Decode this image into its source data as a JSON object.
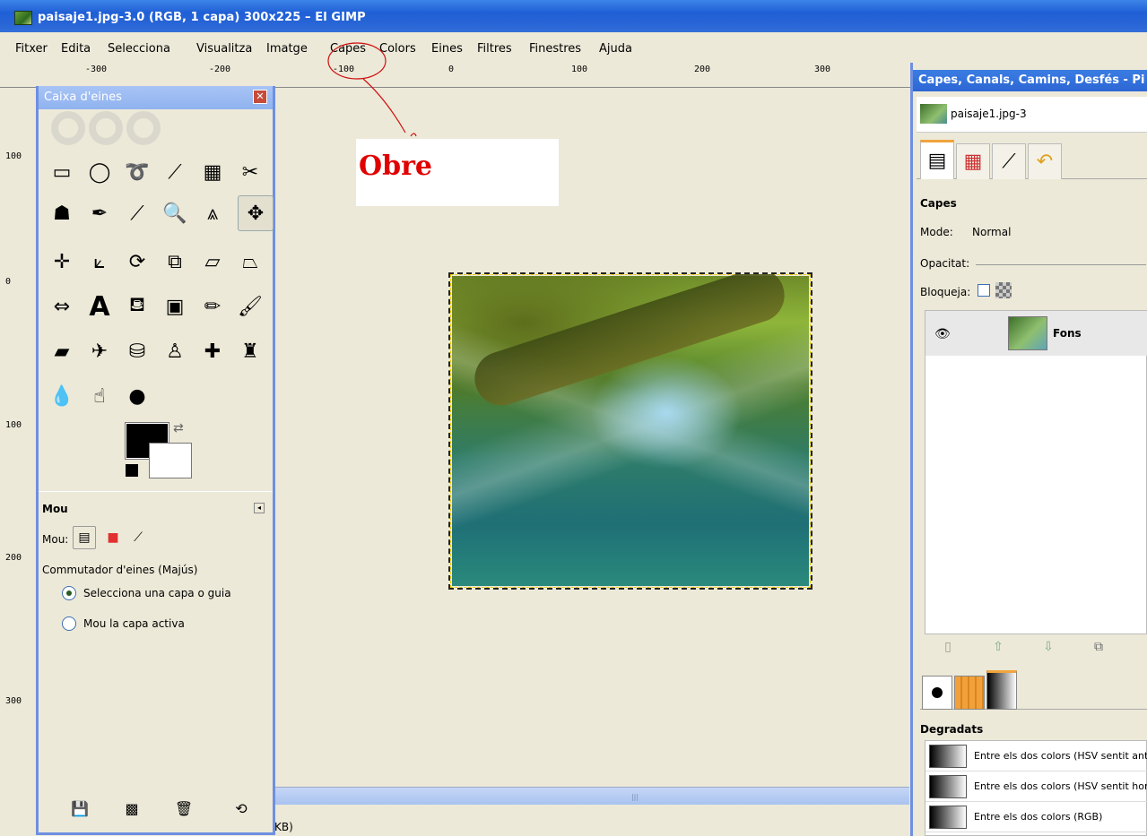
{
  "window": {
    "title": "paisaje1.jpg-3.0 (RGB, 1 capa) 300x225 – El GIMP"
  },
  "menu": [
    "Fitxer",
    "Edita",
    "Selecciona",
    "Visualitza",
    "Imatge",
    "Capes",
    "Colors",
    "Eines",
    "Filtres",
    "Finestres",
    "Ajuda"
  ],
  "ruler": {
    "h_labels": [
      "-300",
      "-200",
      "-100",
      "0",
      "100",
      "200",
      "300"
    ],
    "v_labels": [
      "100",
      "0",
      "100",
      "200",
      "300"
    ]
  },
  "annotation": {
    "text": "Obre",
    "color": "#e00000"
  },
  "status": {
    "text": "KB)"
  },
  "toolbox": {
    "title": "Caixa d'eines",
    "tools": [
      "rect-select-icon",
      "ellipse-select-icon",
      "free-select-icon",
      "fuzzy-select-icon",
      "select-by-color-icon",
      "scissors-icon",
      "foreground-select-icon",
      "paths-icon",
      "color-picker-icon",
      "zoom-icon",
      "measure-icon",
      "move-icon",
      "align-icon",
      "crop-icon",
      "rotate-icon",
      "scale-icon",
      "shear-icon",
      "perspective-icon",
      "flip-icon",
      "text-icon",
      "bucket-fill-icon",
      "blend-icon",
      "pencil-icon",
      "paintbrush-icon",
      "eraser-icon",
      "airbrush-icon",
      "ink-icon",
      "clone-icon",
      "heal-icon",
      "perspective-clone-icon",
      "blur-icon",
      "smudge-icon",
      "dodge-burn-icon"
    ],
    "fg_color": "#000000",
    "bg_color": "#ffffff",
    "options": {
      "title": "Mou",
      "mode_label": "Mou:",
      "switcher_label": "Commutador d'eines (Majús)",
      "radio1": "Selecciona una capa o guia",
      "radio2": "Mou la capa activa"
    }
  },
  "dock": {
    "title": "Capes, Canals, Camins, Desfés - Pi",
    "image_name": "paisaje1.jpg-3",
    "layers": {
      "section": "Capes",
      "mode_label": "Mode:",
      "mode_value": "Normal",
      "opacity_label": "Opacitat:",
      "lock_label": "Bloqueja:",
      "layer_name": "Fons"
    },
    "gradients": {
      "section": "Degradats",
      "items": [
        "Entre els dos colors (HSV sentit ant",
        "Entre els dos colors (HSV sentit hor",
        "Entre els dos colors (RGB)"
      ]
    }
  }
}
